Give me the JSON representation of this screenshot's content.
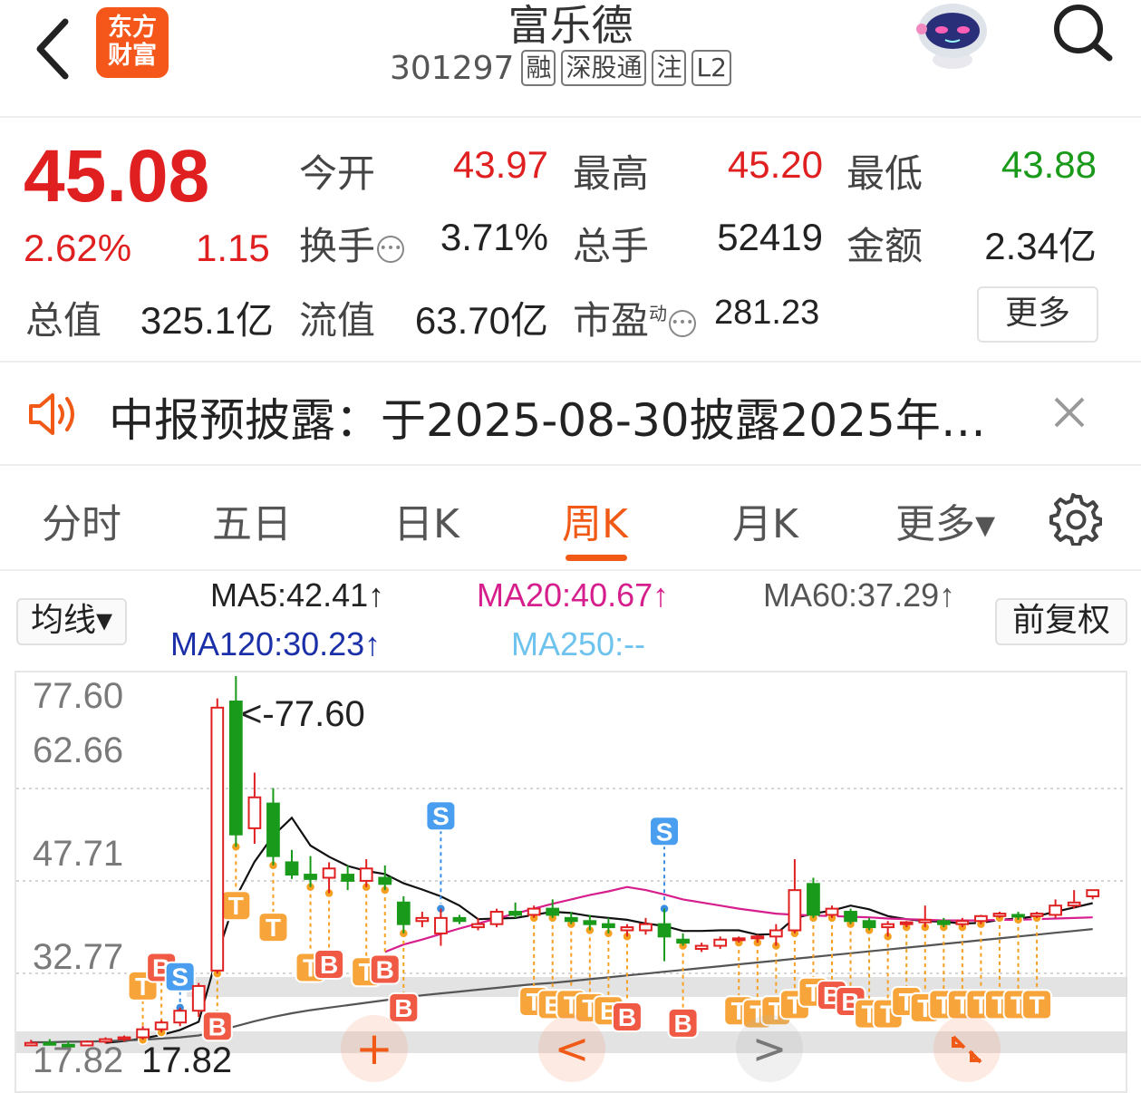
{
  "header": {
    "app_logo_text": [
      "东方",
      "财富"
    ],
    "stock_name": "富乐德",
    "stock_code": "301297",
    "tags": [
      "融",
      "深股通",
      "注",
      "L2"
    ]
  },
  "quote": {
    "price": "45.08",
    "change_pct": "2.62%",
    "change_amt": "1.15",
    "open": {
      "label": "今开",
      "value": "43.97"
    },
    "high": {
      "label": "最高",
      "value": "45.20"
    },
    "low": {
      "label": "最低",
      "value": "43.88"
    },
    "turnover": {
      "label": "换手",
      "value": "3.71%"
    },
    "volume": {
      "label": "总手",
      "value": "52419"
    },
    "amount": {
      "label": "金额",
      "value": "2.34亿"
    },
    "total_cap": {
      "label": "总值",
      "value": "325.1亿"
    },
    "float_cap": {
      "label": "流值",
      "value": "63.70亿"
    },
    "pe": {
      "label": "市盈",
      "sup": "动",
      "value": "281.23"
    },
    "more_button": "更多"
  },
  "notice": {
    "text": "中报预披露：于2025-08-30披露2025年…"
  },
  "tabs": {
    "items": [
      "分时",
      "五日",
      "日K",
      "周K",
      "月K",
      "更多▾"
    ],
    "active": "周K"
  },
  "indicators": {
    "ma_selector": "均线▾",
    "ma5": "MA5:42.41↑",
    "ma20": "MA20:40.67↑",
    "ma60": "MA60:37.29↑",
    "ma120": "MA120:30.23↑",
    "ma250": "MA250:--",
    "adjust_button": "前复权",
    "colors": {
      "ma5": "#222222",
      "ma20": "#d61f8c",
      "ma60": "#555555",
      "ma120": "#1b2fa8",
      "ma250": "#6ec3ee"
    }
  },
  "chart_data": {
    "type": "candlestick",
    "y_labels": [
      "77.60",
      "62.66",
      "47.71",
      "32.77",
      "17.82"
    ],
    "max_annotation": "<-77.60",
    "min_annotation": "17.82",
    "up_color": "#e02020",
    "down_color": "#1a9a1a",
    "candles": [
      {
        "o": 17.9,
        "h": 18.8,
        "l": 17.82,
        "c": 18.3
      },
      {
        "o": 18.3,
        "h": 18.9,
        "l": 17.9,
        "c": 18.0
      },
      {
        "o": 18.0,
        "h": 18.6,
        "l": 17.82,
        "c": 17.9
      },
      {
        "o": 17.9,
        "h": 18.7,
        "l": 17.9,
        "c": 18.5
      },
      {
        "o": 18.5,
        "h": 19.2,
        "l": 18.2,
        "c": 18.9
      },
      {
        "o": 18.9,
        "h": 19.5,
        "l": 18.5,
        "c": 19.2
      },
      {
        "o": 19.2,
        "h": 21.0,
        "l": 18.8,
        "c": 20.5
      },
      {
        "o": 20.5,
        "h": 22.0,
        "l": 20.0,
        "c": 21.6
      },
      {
        "o": 21.6,
        "h": 24.0,
        "l": 21.0,
        "c": 23.5
      },
      {
        "o": 23.5,
        "h": 28.0,
        "l": 22.5,
        "c": 27.5
      },
      {
        "o": 30.0,
        "h": 74.0,
        "l": 29.5,
        "c": 72.5
      },
      {
        "o": 73.5,
        "h": 77.6,
        "l": 50.0,
        "c": 52.0
      },
      {
        "o": 53.0,
        "h": 62.0,
        "l": 50.5,
        "c": 58.0
      },
      {
        "o": 57.0,
        "h": 59.5,
        "l": 47.0,
        "c": 48.5
      },
      {
        "o": 47.5,
        "h": 49.5,
        "l": 44.8,
        "c": 45.5
      },
      {
        "o": 45.5,
        "h": 48.5,
        "l": 43.5,
        "c": 44.8
      },
      {
        "o": 45.0,
        "h": 47.5,
        "l": 42.5,
        "c": 46.5
      },
      {
        "o": 45.5,
        "h": 47.0,
        "l": 43.0,
        "c": 44.5
      },
      {
        "o": 44.5,
        "h": 48.0,
        "l": 43.5,
        "c": 46.5
      },
      {
        "o": 45.0,
        "h": 47.0,
        "l": 43.0,
        "c": 44.0
      },
      {
        "o": 41.0,
        "h": 42.0,
        "l": 36.0,
        "c": 37.5
      },
      {
        "o": 38.0,
        "h": 39.5,
        "l": 37.0,
        "c": 38.5
      },
      {
        "o": 36.0,
        "h": 40.0,
        "l": 34.0,
        "c": 38.5
      },
      {
        "o": 38.5,
        "h": 39.0,
        "l": 37.5,
        "c": 38.0
      },
      {
        "o": 37.0,
        "h": 38.5,
        "l": 36.5,
        "c": 37.5
      },
      {
        "o": 37.5,
        "h": 40.0,
        "l": 37.0,
        "c": 39.5
      },
      {
        "o": 39.5,
        "h": 41.0,
        "l": 38.5,
        "c": 39.0
      },
      {
        "o": 39.0,
        "h": 40.5,
        "l": 38.5,
        "c": 40.0
      },
      {
        "o": 40.0,
        "h": 41.5,
        "l": 38.5,
        "c": 39.0
      },
      {
        "o": 38.5,
        "h": 39.5,
        "l": 37.5,
        "c": 38.0
      },
      {
        "o": 38.0,
        "h": 39.0,
        "l": 36.5,
        "c": 37.5
      },
      {
        "o": 37.5,
        "h": 38.5,
        "l": 36.0,
        "c": 37.0
      },
      {
        "o": 36.5,
        "h": 37.5,
        "l": 35.5,
        "c": 37.0
      },
      {
        "o": 36.5,
        "h": 38.5,
        "l": 35.8,
        "c": 37.5
      },
      {
        "o": 37.5,
        "h": 40.0,
        "l": 31.5,
        "c": 35.5
      },
      {
        "o": 35.0,
        "h": 36.0,
        "l": 34.0,
        "c": 34.5
      },
      {
        "o": 33.5,
        "h": 34.5,
        "l": 33.0,
        "c": 34.0
      },
      {
        "o": 34.0,
        "h": 35.5,
        "l": 33.5,
        "c": 35.0
      },
      {
        "o": 35.0,
        "h": 35.5,
        "l": 34.5,
        "c": 35.2
      },
      {
        "o": 35.2,
        "h": 35.8,
        "l": 34.5,
        "c": 35.5
      },
      {
        "o": 35.5,
        "h": 37.5,
        "l": 34.0,
        "c": 36.5
      },
      {
        "o": 36.5,
        "h": 48.0,
        "l": 36.0,
        "c": 43.0
      },
      {
        "o": 44.0,
        "h": 45.0,
        "l": 38.5,
        "c": 39.0
      },
      {
        "o": 39.0,
        "h": 40.5,
        "l": 38.5,
        "c": 40.0
      },
      {
        "o": 39.5,
        "h": 40.0,
        "l": 37.5,
        "c": 38.0
      },
      {
        "o": 38.0,
        "h": 38.5,
        "l": 36.5,
        "c": 37.0
      },
      {
        "o": 37.0,
        "h": 38.0,
        "l": 35.5,
        "c": 37.5
      },
      {
        "o": 37.5,
        "h": 38.0,
        "l": 37.0,
        "c": 37.8
      },
      {
        "o": 37.8,
        "h": 40.5,
        "l": 37.0,
        "c": 38.2
      },
      {
        "o": 38.0,
        "h": 38.5,
        "l": 37.0,
        "c": 37.5
      },
      {
        "o": 37.5,
        "h": 38.5,
        "l": 37.0,
        "c": 38.0
      },
      {
        "o": 38.0,
        "h": 39.0,
        "l": 37.5,
        "c": 38.8
      },
      {
        "o": 38.8,
        "h": 39.5,
        "l": 38.5,
        "c": 39.2
      },
      {
        "o": 39.0,
        "h": 39.5,
        "l": 38.2,
        "c": 38.8
      },
      {
        "o": 38.8,
        "h": 39.5,
        "l": 38.5,
        "c": 39.2
      },
      {
        "o": 39.0,
        "h": 41.5,
        "l": 38.5,
        "c": 40.5
      },
      {
        "o": 40.5,
        "h": 43.0,
        "l": 40.0,
        "c": 41.0
      },
      {
        "o": 42.0,
        "h": 43.0,
        "l": 41.5,
        "c": 43.0
      }
    ],
    "ma_lines": {
      "ma5": [
        null,
        null,
        null,
        null,
        18.3,
        18.6,
        19.0,
        19.6,
        20.4,
        21.7,
        32.5,
        41.8,
        47.6,
        51.8,
        54.7,
        50.2,
        48.4,
        46.9,
        46.1,
        45.6,
        44.1,
        43.1,
        42.0,
        40.5,
        38.3,
        38.4,
        38.5,
        39.0,
        39.5,
        39.3,
        38.8,
        38.5,
        38.2,
        37.6,
        37.2,
        36.4,
        36.4,
        36.5,
        36.5,
        35.8,
        35.9,
        38.5,
        39.2,
        39.7,
        40.5,
        39.9,
        38.8,
        38.3,
        38.0,
        37.9,
        37.6,
        37.7,
        38.2,
        38.4,
        38.8,
        39.5,
        40.2,
        40.9
      ],
      "ma20": [
        null,
        null,
        null,
        null,
        null,
        null,
        null,
        null,
        null,
        null,
        null,
        null,
        null,
        null,
        null,
        null,
        null,
        null,
        null,
        33.0,
        34.2,
        35.0,
        35.9,
        36.8,
        37.6,
        38.4,
        39.2,
        40.0,
        40.8,
        41.5,
        42.2,
        42.8,
        43.5,
        43.0,
        42.3,
        41.5,
        41.0,
        40.5,
        40.0,
        39.6,
        39.2,
        39.0,
        38.9,
        38.8,
        38.7,
        38.6,
        38.4,
        38.3,
        38.2,
        38.1,
        38.1,
        38.1,
        38.2,
        38.2,
        38.3,
        38.4,
        38.5,
        38.6
      ],
      "ma60": [
        18.4,
        18.4,
        18.5,
        18.5,
        18.6,
        18.7,
        18.8,
        19.0,
        19.2,
        19.5,
        20.2,
        21.0,
        21.8,
        22.5,
        23.1,
        23.6,
        24.0,
        24.4,
        24.8,
        25.2,
        25.6,
        26.0,
        26.3,
        26.6,
        26.9,
        27.2,
        27.5,
        27.8,
        28.0,
        28.3,
        28.6,
        28.9,
        29.2,
        29.5,
        29.8,
        30.1,
        30.4,
        30.7,
        31.0,
        31.3,
        31.6,
        31.9,
        32.2,
        32.5,
        32.8,
        33.1,
        33.4,
        33.7,
        34.0,
        34.3,
        34.6,
        34.9,
        35.2,
        35.5,
        35.8,
        36.1,
        36.4,
        36.7
      ]
    },
    "signals": [
      {
        "label": "T",
        "idx": 6,
        "price": 27.5
      },
      {
        "label": "B",
        "idx": 7,
        "price": 30.5
      },
      {
        "label": "S",
        "idx": 8,
        "price": 29.0
      },
      {
        "label": "B",
        "idx": 10,
        "price": 21.0
      },
      {
        "label": "T",
        "idx": 11,
        "price": 40.5
      },
      {
        "label": "T",
        "idx": 13,
        "price": 37.0
      },
      {
        "label": "T",
        "idx": 15,
        "price": 30.5
      },
      {
        "label": "B",
        "idx": 16,
        "price": 31.0
      },
      {
        "label": "T",
        "idx": 18,
        "price": 29.8
      },
      {
        "label": "B",
        "idx": 19,
        "price": 30.2
      },
      {
        "label": "B",
        "idx": 20,
        "price": 24.0
      },
      {
        "label": "S",
        "idx": 22,
        "price": 55.0
      },
      {
        "label": "T",
        "idx": 27,
        "price": 25.0
      },
      {
        "label": "E",
        "idx": 28,
        "price": 24.5
      },
      {
        "label": "T",
        "idx": 29,
        "price": 24.5
      },
      {
        "label": "T",
        "idx": 30,
        "price": 24.0
      },
      {
        "label": "E",
        "idx": 31,
        "price": 23.5
      },
      {
        "label": "B",
        "idx": 32,
        "price": 22.5
      },
      {
        "label": "S",
        "idx": 34,
        "price": 52.5
      },
      {
        "label": "B",
        "idx": 35,
        "price": 21.5
      },
      {
        "label": "T",
        "idx": 38,
        "price": 23.5
      },
      {
        "label": "T",
        "idx": 39,
        "price": 23.0
      },
      {
        "label": "T",
        "idx": 40,
        "price": 23.5
      },
      {
        "label": "T",
        "idx": 41,
        "price": 24.5
      },
      {
        "label": "T",
        "idx": 42,
        "price": 26.5
      },
      {
        "label": "B",
        "idx": 43,
        "price": 26.0
      },
      {
        "label": "B",
        "idx": 44,
        "price": 25.0
      },
      {
        "label": "T",
        "idx": 45,
        "price": 23.0
      },
      {
        "label": "T",
        "idx": 46,
        "price": 23.0
      },
      {
        "label": "T",
        "idx": 47,
        "price": 25.0
      },
      {
        "label": "T",
        "idx": 48,
        "price": 24.0
      },
      {
        "label": "T",
        "idx": 49,
        "price": 24.5
      },
      {
        "label": "T",
        "idx": 50,
        "price": 24.5
      },
      {
        "label": "T",
        "idx": 51,
        "price": 24.5
      },
      {
        "label": "T",
        "idx": 52,
        "price": 24.5
      },
      {
        "label": "T",
        "idx": 53,
        "price": 24.5
      },
      {
        "label": "T",
        "idx": 54,
        "price": 24.5
      }
    ]
  },
  "chart_controls": [
    "+",
    "<",
    ">",
    "collapse"
  ]
}
